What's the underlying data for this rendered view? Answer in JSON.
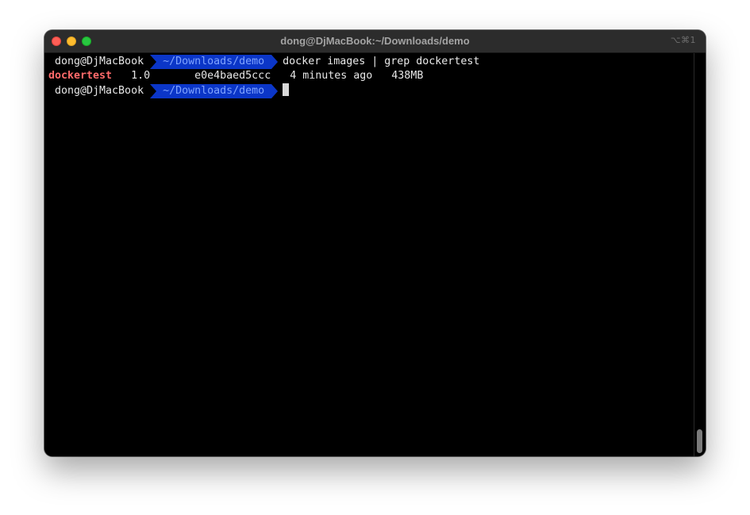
{
  "window": {
    "title": "dong@DjMacBook:~/Downloads/demo",
    "shortcut": "⌥⌘1"
  },
  "terminal": {
    "prompt_host": "dong@DjMacBook",
    "prompt_path": "~/Downloads/demo",
    "lines": [
      {
        "type": "command",
        "command": "docker images | grep dockertest"
      },
      {
        "type": "output",
        "repository": "dockertest",
        "rest": "   1.0       e0e4baed5ccc   4 minutes ago   438MB"
      },
      {
        "type": "prompt",
        "command": ""
      }
    ]
  },
  "colors": {
    "terminal_bg": "#000000",
    "path_segment_bg": "#0b36c8",
    "path_segment_fg": "#7fa3ff",
    "repository_name": "#ff6b6b",
    "close": "#fe5f57",
    "minimize": "#febc2e",
    "zoom": "#28c840"
  },
  "icons": {
    "close": "close-traffic-light",
    "minimize": "minimize-traffic-light",
    "zoom": "zoom-traffic-light"
  }
}
